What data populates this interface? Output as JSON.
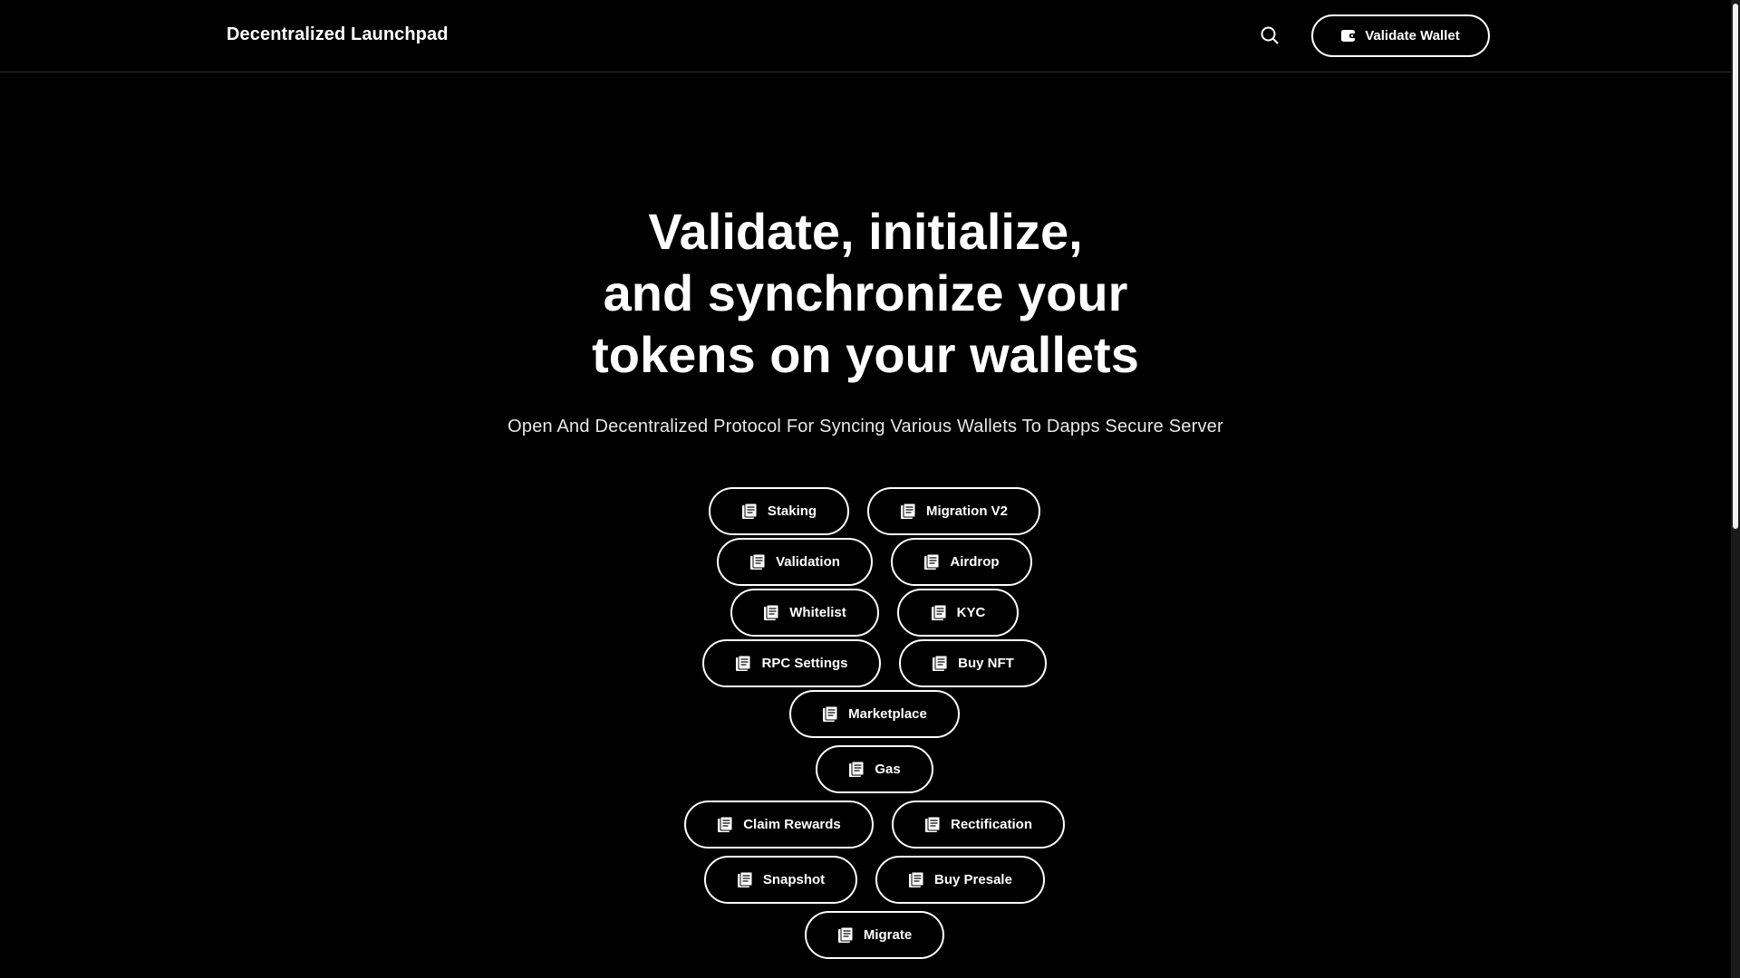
{
  "header": {
    "brand": "Decentralized Launchpad",
    "search_icon": "search-icon",
    "wallet_button_label": "Validate Wallet",
    "wallet_icon": "wallet-icon"
  },
  "hero": {
    "title_lines": [
      "Validate, initialize,",
      "and synchronize your",
      "tokens on your wallets"
    ],
    "subtitle": "Open And Decentralized Protocol For Syncing Various Wallets To Dapps Secure Server"
  },
  "actions": {
    "icon": "document-icon",
    "items": [
      {
        "label": "Staking"
      },
      {
        "label": "Migration V2"
      },
      {
        "label": "Validation"
      },
      {
        "label": "Airdrop"
      },
      {
        "label": "Whitelist"
      },
      {
        "label": "KYC"
      },
      {
        "label": "RPC Settings"
      },
      {
        "label": "Buy NFT"
      },
      {
        "label": "Marketplace"
      },
      {
        "label": "Gas"
      },
      {
        "label": "Claim Rewards"
      },
      {
        "label": "Rectification"
      },
      {
        "label": "Snapshot"
      },
      {
        "label": "Buy Presale"
      },
      {
        "label": "Migrate"
      }
    ]
  },
  "colors": {
    "background": "#000000",
    "foreground": "#ffffff"
  }
}
